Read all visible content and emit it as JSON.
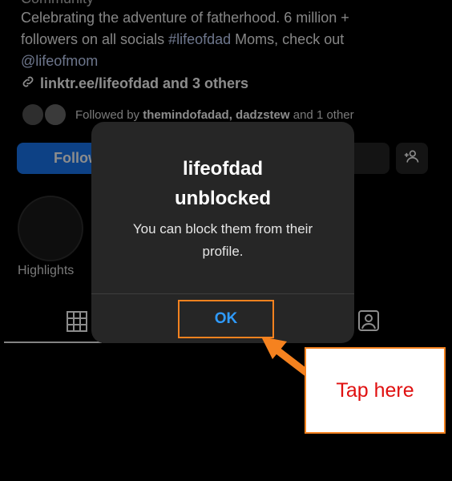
{
  "profile": {
    "category_partial": "Community",
    "bio_lines": [
      "Celebrating the adventure of fatherhood. 6 million +",
      "followers on all socials ",
      "Moms, check out",
      "@lifeofmom"
    ],
    "hashtag": "#lifeofdad",
    "link_text": "linktr.ee/lifeofdad and 3 others",
    "followed_by_prefix": "Followed by ",
    "followed_by_names": "themindofadad, dadzstew",
    "followed_by_suffix": " and 1 other",
    "follow_label": "Follow",
    "highlights_label": "Highlights"
  },
  "modal": {
    "title_line1": "lifeofdad",
    "title_line2": "unblocked",
    "message": "You can block them from their profile.",
    "ok_label": "OK"
  },
  "annotation": {
    "callout_text": "Tap here",
    "accent_color": "#f5821f",
    "text_color": "#e01010"
  },
  "icons": [
    "link-icon",
    "add-person-icon",
    "grid-icon",
    "tagged-icon"
  ]
}
